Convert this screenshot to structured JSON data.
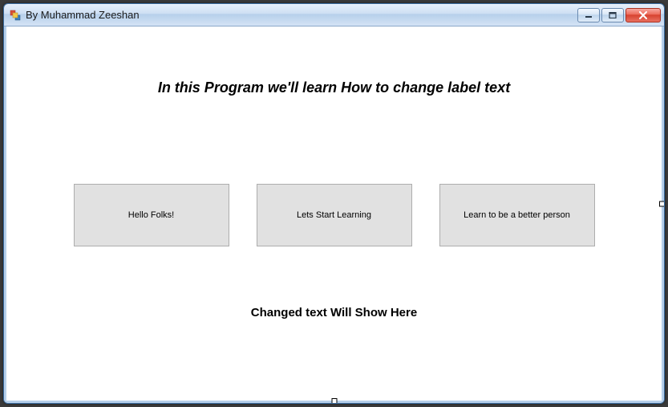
{
  "window": {
    "title": "By Muhammad Zeeshan"
  },
  "heading": "In this Program we'll learn How to change label text",
  "buttons": {
    "b1": "Hello Folks!",
    "b2": "Lets Start Learning",
    "b3": "Learn to be a better person"
  },
  "output_label": "Changed text Will Show Here"
}
